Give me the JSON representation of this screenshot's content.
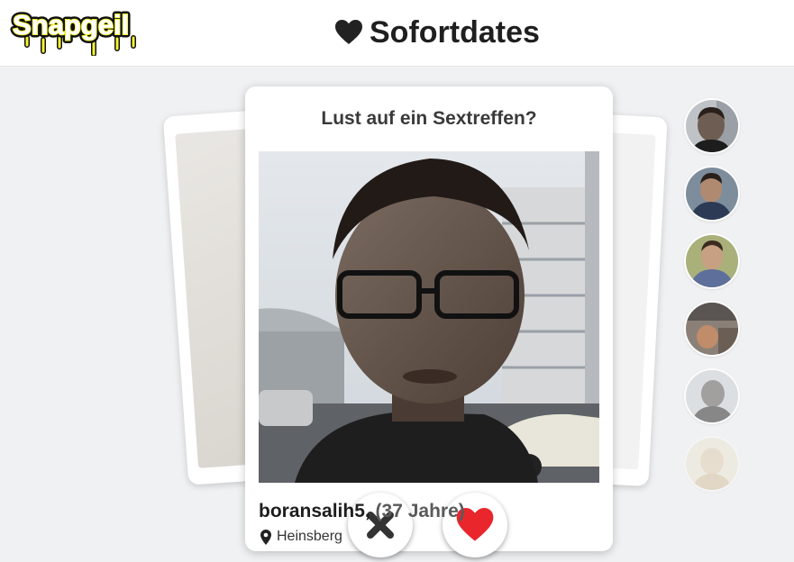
{
  "header": {
    "logo_text": "Snapgeil",
    "title": "Sofortdates"
  },
  "card": {
    "question": "Lust auf ein Sextreffen?",
    "username": "boransalih5,",
    "age": "(37 Jahre)",
    "location": "Heinsberg"
  },
  "icons": {
    "title": "heart-icon",
    "dislike": "close-x-icon",
    "like": "heart-icon",
    "location": "map-pin-icon"
  },
  "colors": {
    "like_red": "#e8262c",
    "dislike_dark": "#333333",
    "logo_yellow": "#f5f233"
  },
  "sidebar": {
    "avatars": [
      {
        "label": "profile-1"
      },
      {
        "label": "profile-2"
      },
      {
        "label": "profile-3"
      },
      {
        "label": "profile-4"
      },
      {
        "label": "profile-5"
      },
      {
        "label": "profile-6"
      }
    ]
  }
}
